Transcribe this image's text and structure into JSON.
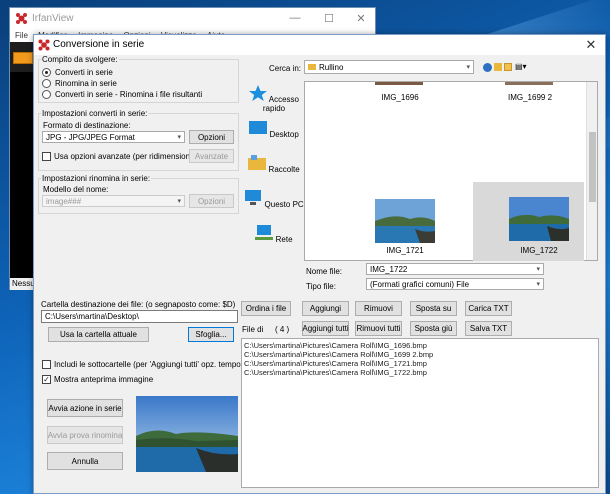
{
  "background_window": {
    "title": "IrfanView",
    "menu": [
      "File",
      "Modifica",
      "Immagine",
      "Opzioni",
      "Visualizza",
      "Aiuto"
    ],
    "status_text": "Nessun file caricato"
  },
  "dialog": {
    "title": "Conversione in serie",
    "close_glyph": "✕",
    "task_group": {
      "legend": "Compito da svolgere:",
      "options": [
        {
          "label": "Converti in serie",
          "selected": true
        },
        {
          "label": "Rinomina in serie",
          "selected": false
        },
        {
          "label": "Converti in serie - Rinomina i file risultanti",
          "selected": false
        }
      ]
    },
    "convert_settings": {
      "legend": "Impostazioni converti in serie:",
      "format_label": "Formato di destinazione:",
      "format_value": "JPG - JPG/JPEG Format",
      "options_button": "Opzioni",
      "advanced_checkbox": "Usa opzioni avanzate (per ridimensiona...)",
      "advanced_checked": false,
      "advanced_button": "Avanzate"
    },
    "rename_settings": {
      "legend": "Impostazioni rinomina in serie:",
      "pattern_label": "Modello del nome:",
      "pattern_value": "image###",
      "options_button": "Opzioni"
    },
    "output": {
      "label": "Cartella destinazione dei file: (o segnaposto come: $D)",
      "value": "C:\\Users\\martina\\Desktop\\",
      "use_current_button": "Usa la cartella attuale",
      "browse_button": "Sfoglia..."
    },
    "include_subfolders": {
      "label": "Includi le sottocartelle (per 'Aggiungi tutti' opz. temporanea)",
      "checked": false
    },
    "show_preview": {
      "label": "Mostra anteprima immagine",
      "checked": true
    },
    "start_button": "Avvia azione in serie",
    "test_rename_button": "Avvia prova rinomina",
    "cancel_button": "Annulla",
    "browser": {
      "lookin_label": "Cerca in:",
      "lookin_value": "Rullino",
      "places": [
        "Accesso rapido",
        "Desktop",
        "Raccolte",
        "Questo PC",
        "Rete"
      ],
      "thumbnails": [
        {
          "name": "IMG_1696",
          "selected": false
        },
        {
          "name": "IMG_1699 2",
          "selected": false
        },
        {
          "name": "IMG_1721",
          "selected": false
        },
        {
          "name": "IMG_1722",
          "selected": true
        }
      ],
      "filename_label": "Nome file:",
      "filename_value": "IMG_1722",
      "filetype_label": "Tipo file:",
      "filetype_value": "(Formati grafici comuni) File"
    },
    "list_buttons": {
      "sort": "Ordina i file",
      "add": "Aggiungi",
      "remove": "Rimuovi",
      "move_up": "Sposta su",
      "load_txt": "Carica TXT",
      "add_all": "Aggiungi tutti",
      "remove_all": "Rimuovi tutti",
      "move_down": "Sposta giù",
      "save_txt": "Salva TXT"
    },
    "files_label": "File di",
    "files_count": "( 4 )",
    "files": [
      "C:\\Users\\martina\\Pictures\\Camera Roll\\IMG_1696.bmp",
      "C:\\Users\\martina\\Pictures\\Camera Roll\\IMG_1699 2.bmp",
      "C:\\Users\\martina\\Pictures\\Camera Roll\\IMG_1721.bmp",
      "C:\\Users\\martina\\Pictures\\Camera Roll\\IMG_1722.bmp"
    ]
  }
}
